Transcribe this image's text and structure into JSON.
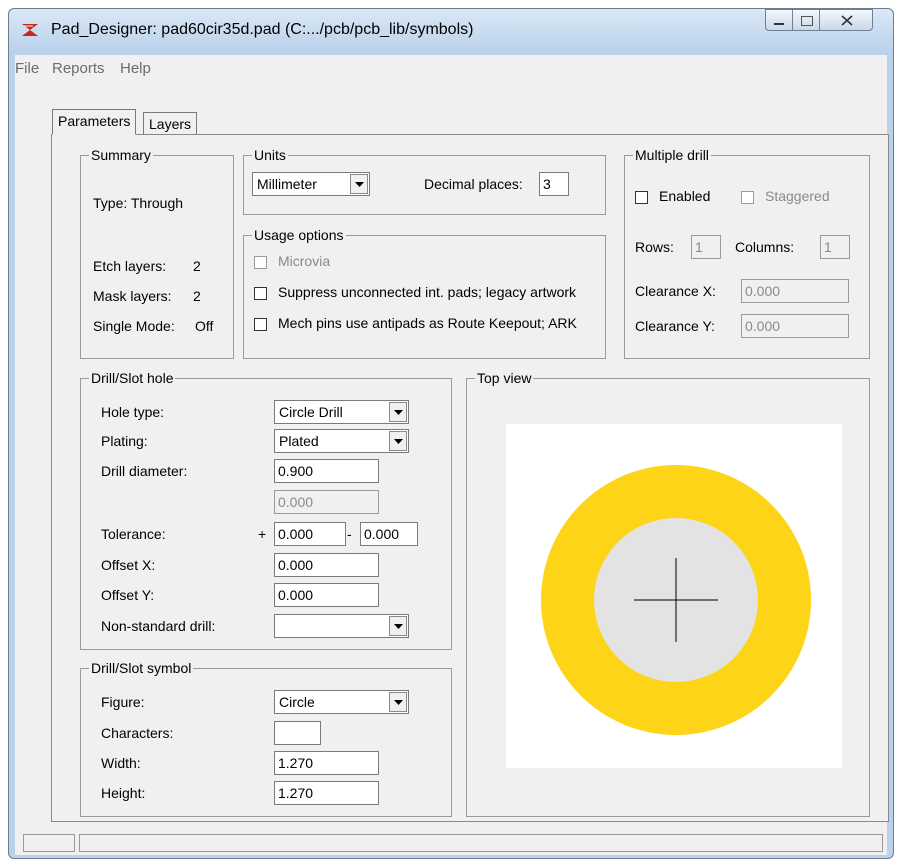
{
  "window": {
    "title": "Pad_Designer: pad60cir35d.pad (C:.../pcb/pcb_lib/symbols)"
  },
  "menu": {
    "file": "File",
    "reports": "Reports",
    "help": "Help"
  },
  "tabs": {
    "parameters": "Parameters",
    "layers": "Layers"
  },
  "summary": {
    "title": "Summary",
    "type": "Type:  Through",
    "etch_label": "Etch layers:",
    "etch_value": "2",
    "mask_label": "Mask layers:",
    "mask_value": "2",
    "single_label": "Single Mode:",
    "single_value": "Off"
  },
  "units": {
    "title": "Units",
    "unit_value": "Millimeter",
    "decimal_label": "Decimal places:",
    "decimal_value": "3"
  },
  "usage": {
    "title": "Usage options",
    "microvia": "Microvia",
    "suppress": "Suppress unconnected int. pads; legacy artwork",
    "mech": "Mech pins use antipads as Route Keepout; ARK"
  },
  "multidrill": {
    "title": "Multiple drill",
    "enabled": "Enabled",
    "staggered": "Staggered",
    "rows_label": "Rows:",
    "rows_value": "1",
    "columns_label": "Columns:",
    "columns_value": "1",
    "clearance_x_label": "Clearance X:",
    "clearance_x_value": "0.000",
    "clearance_y_label": "Clearance Y:",
    "clearance_y_value": "0.000"
  },
  "drill_hole": {
    "title": "Drill/Slot hole",
    "hole_type_label": "Hole type:",
    "hole_type_value": "Circle Drill",
    "plating_label": "Plating:",
    "plating_value": "Plated",
    "diameter_label": "Drill diameter:",
    "diameter_value": "0.900",
    "diameter_extra": "0.000",
    "tolerance_label": "Tolerance:",
    "plus": "+",
    "minus": "-",
    "tol_plus_value": "0.000",
    "tol_minus_value": "0.000",
    "offset_x_label": "Offset X:",
    "offset_x_value": "0.000",
    "offset_y_label": "Offset Y:",
    "offset_y_value": "0.000",
    "nonstd_label": "Non-standard drill:",
    "nonstd_value": ""
  },
  "drill_symbol": {
    "title": "Drill/Slot symbol",
    "figure_label": "Figure:",
    "figure_value": "Circle",
    "chars_label": "Characters:",
    "chars_value": "",
    "width_label": "Width:",
    "width_value": "1.270",
    "height_label": "Height:",
    "height_value": "1.270"
  },
  "top_view": {
    "title": "Top view"
  },
  "colors": {
    "pad": "#fdd417",
    "hole": "#e3e3e3",
    "canvas": "#ffffff"
  }
}
